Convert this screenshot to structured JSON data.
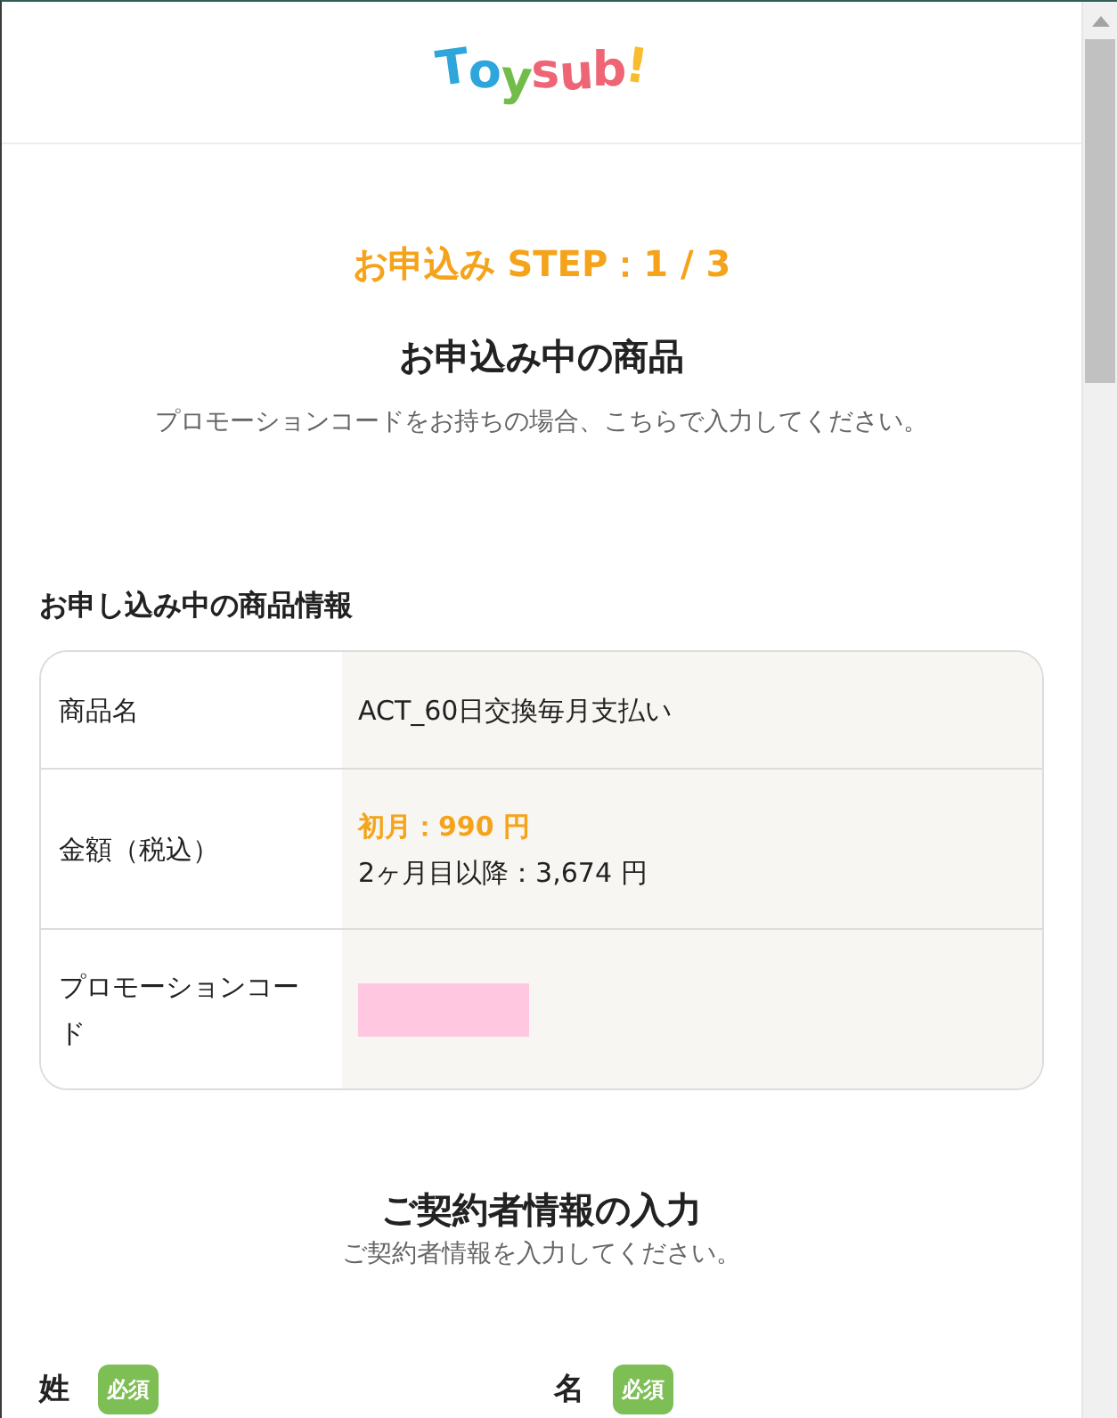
{
  "header": {
    "logo": "Toysub!"
  },
  "step": "お申込み STEP：1 / 3",
  "product_section": {
    "title": "お申込み中の商品",
    "description": "プロモーションコードをお持ちの場合、こちらで入力してください。"
  },
  "product_info": {
    "heading": "お申し込み中の商品情報",
    "rows": [
      {
        "kind": "text",
        "label": "商品名",
        "value": "ACT_60日交換毎月支払い"
      },
      {
        "kind": "price",
        "label": "金額（税込）",
        "first_month": "初月：990 円",
        "regular": "2ヶ月目以降：3,674 円"
      },
      {
        "kind": "redacted",
        "label": "プロモーションコード"
      }
    ]
  },
  "contract_section": {
    "title": "ご契約者情報の入力",
    "description": "ご契約者情報を入力してください。"
  },
  "fields": [
    {
      "label": "姓",
      "required": true,
      "badge": "必須"
    },
    {
      "label": "名",
      "required": true,
      "badge": "必須"
    }
  ]
}
